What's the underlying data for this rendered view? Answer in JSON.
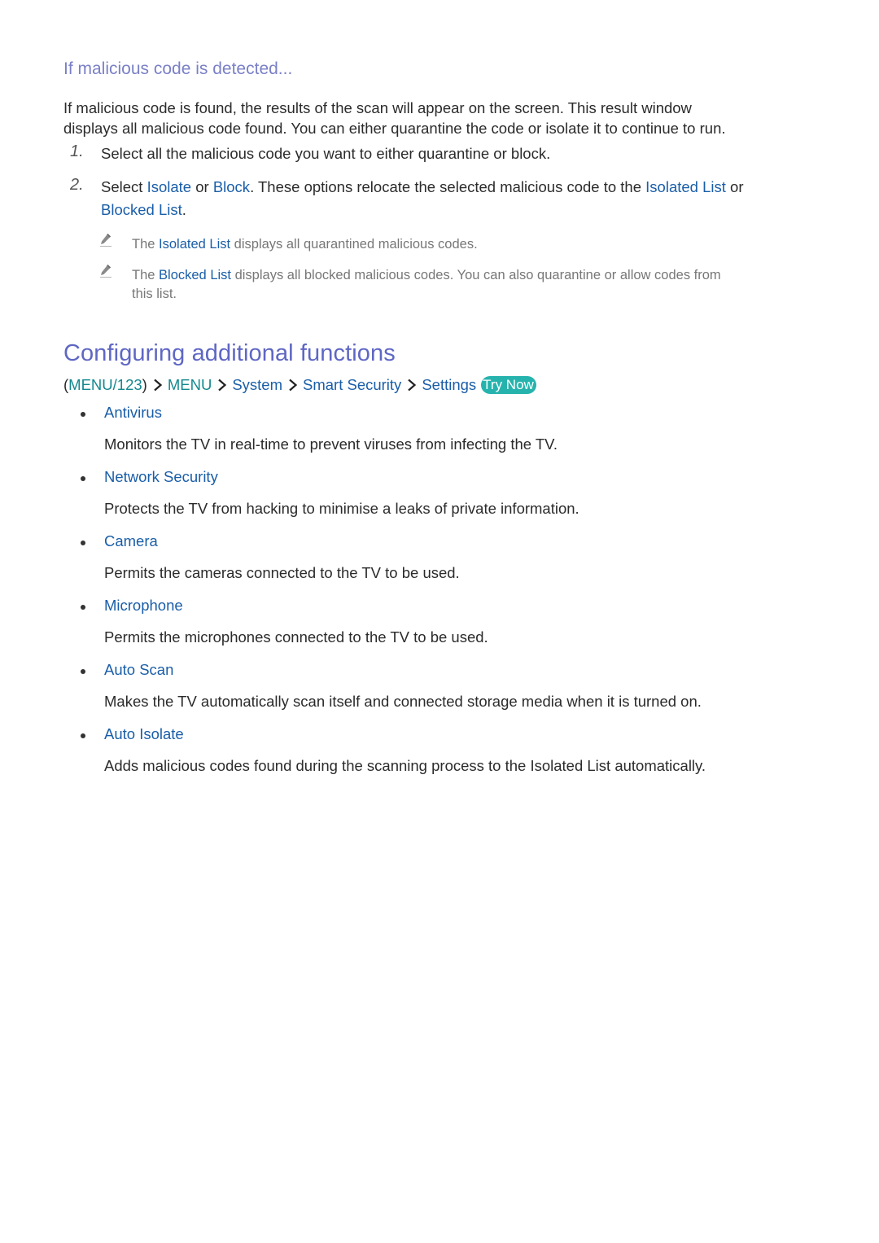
{
  "section1": {
    "heading": "If malicious code is detected...",
    "intro_line1": "If malicious code is found, the results of the scan will appear on the screen. This result window",
    "intro_line2": "displays all malicious code found. You can either quarantine the code or isolate it to continue to run.",
    "steps": [
      {
        "number": "1.",
        "text": "Select all the malicious code you want to either quarantine or block."
      },
      {
        "number": "2.",
        "parts": {
          "t1": "Select ",
          "l1": "Isolate",
          "t2": " or ",
          "l2": "Block",
          "t3": ". These options relocate the selected malicious code to the ",
          "l3": "Isolated List",
          "t4": " or",
          "l4": "Blocked List",
          "t5": "."
        }
      }
    ],
    "notes": [
      {
        "icon": "pencil-icon",
        "t1": "The ",
        "link": "Isolated List",
        "t2": " displays all quarantined malicious codes."
      },
      {
        "icon": "pencil-icon",
        "t1": "The ",
        "link": "Blocked List",
        "t2": " displays all blocked malicious codes. You can also quarantine or allow codes from",
        "t3": "this list."
      }
    ]
  },
  "section2": {
    "heading": "Configuring additional functions",
    "breadcrumb": {
      "open_paren": "(",
      "menu123": "MENU/123",
      "close_paren": ")",
      "items": [
        "MENU",
        "System",
        "Smart Security",
        "Settings"
      ],
      "try_now": "Try Now"
    },
    "items": [
      {
        "title": "Antivirus",
        "desc": "Monitors the TV in real-time to prevent viruses from infecting the TV."
      },
      {
        "title": "Network Security",
        "desc": "Protects the TV from hacking to minimise a leaks of private information."
      },
      {
        "title": "Camera",
        "desc": "Permits the cameras connected to the TV to be used."
      },
      {
        "title": "Microphone",
        "desc": "Permits the microphones connected to the TV to be used."
      },
      {
        "title": "Auto Scan",
        "desc": "Makes the TV automatically scan itself and connected storage media when it is turned on."
      },
      {
        "title": "Auto Isolate",
        "desc": "Adds malicious codes found during the scanning process to the Isolated List automatically."
      }
    ]
  },
  "colors": {
    "heading": "#7a80c6",
    "title": "#5f67c4",
    "link": "#1a5ea8",
    "teal": "#14888f",
    "try_now_bg": "#27b3ad"
  }
}
